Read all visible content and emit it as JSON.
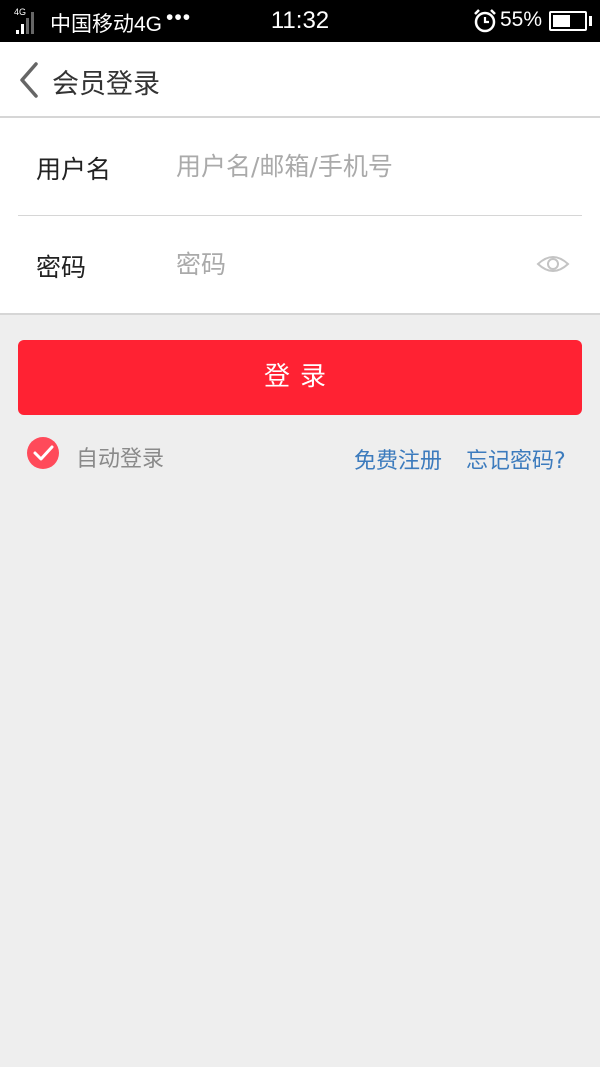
{
  "status_bar": {
    "network_tag": "4G",
    "carrier": "中国移动4G",
    "overflow_dots": "•••",
    "time": "11:32",
    "battery_percent": "55%",
    "battery_level": 0.55
  },
  "nav": {
    "back_icon": "chevron-left-icon",
    "title": "会员登录"
  },
  "form": {
    "username": {
      "label": "用户名",
      "value": "",
      "placeholder": "用户名/邮箱/手机号"
    },
    "password": {
      "label": "密码",
      "value": "",
      "placeholder": "密码",
      "toggle_icon": "eye-icon"
    }
  },
  "login_button": {
    "label": "登录"
  },
  "options": {
    "auto_login": {
      "label": "自动登录",
      "checked": true,
      "icon": "checkmark-circle-icon"
    },
    "register_link": "免费注册",
    "forgot_link": "忘记密码?"
  },
  "colors": {
    "primary": "#ff2233",
    "link": "#3c7bbd",
    "background": "#eeeeee",
    "check": "#ff4a5a"
  }
}
